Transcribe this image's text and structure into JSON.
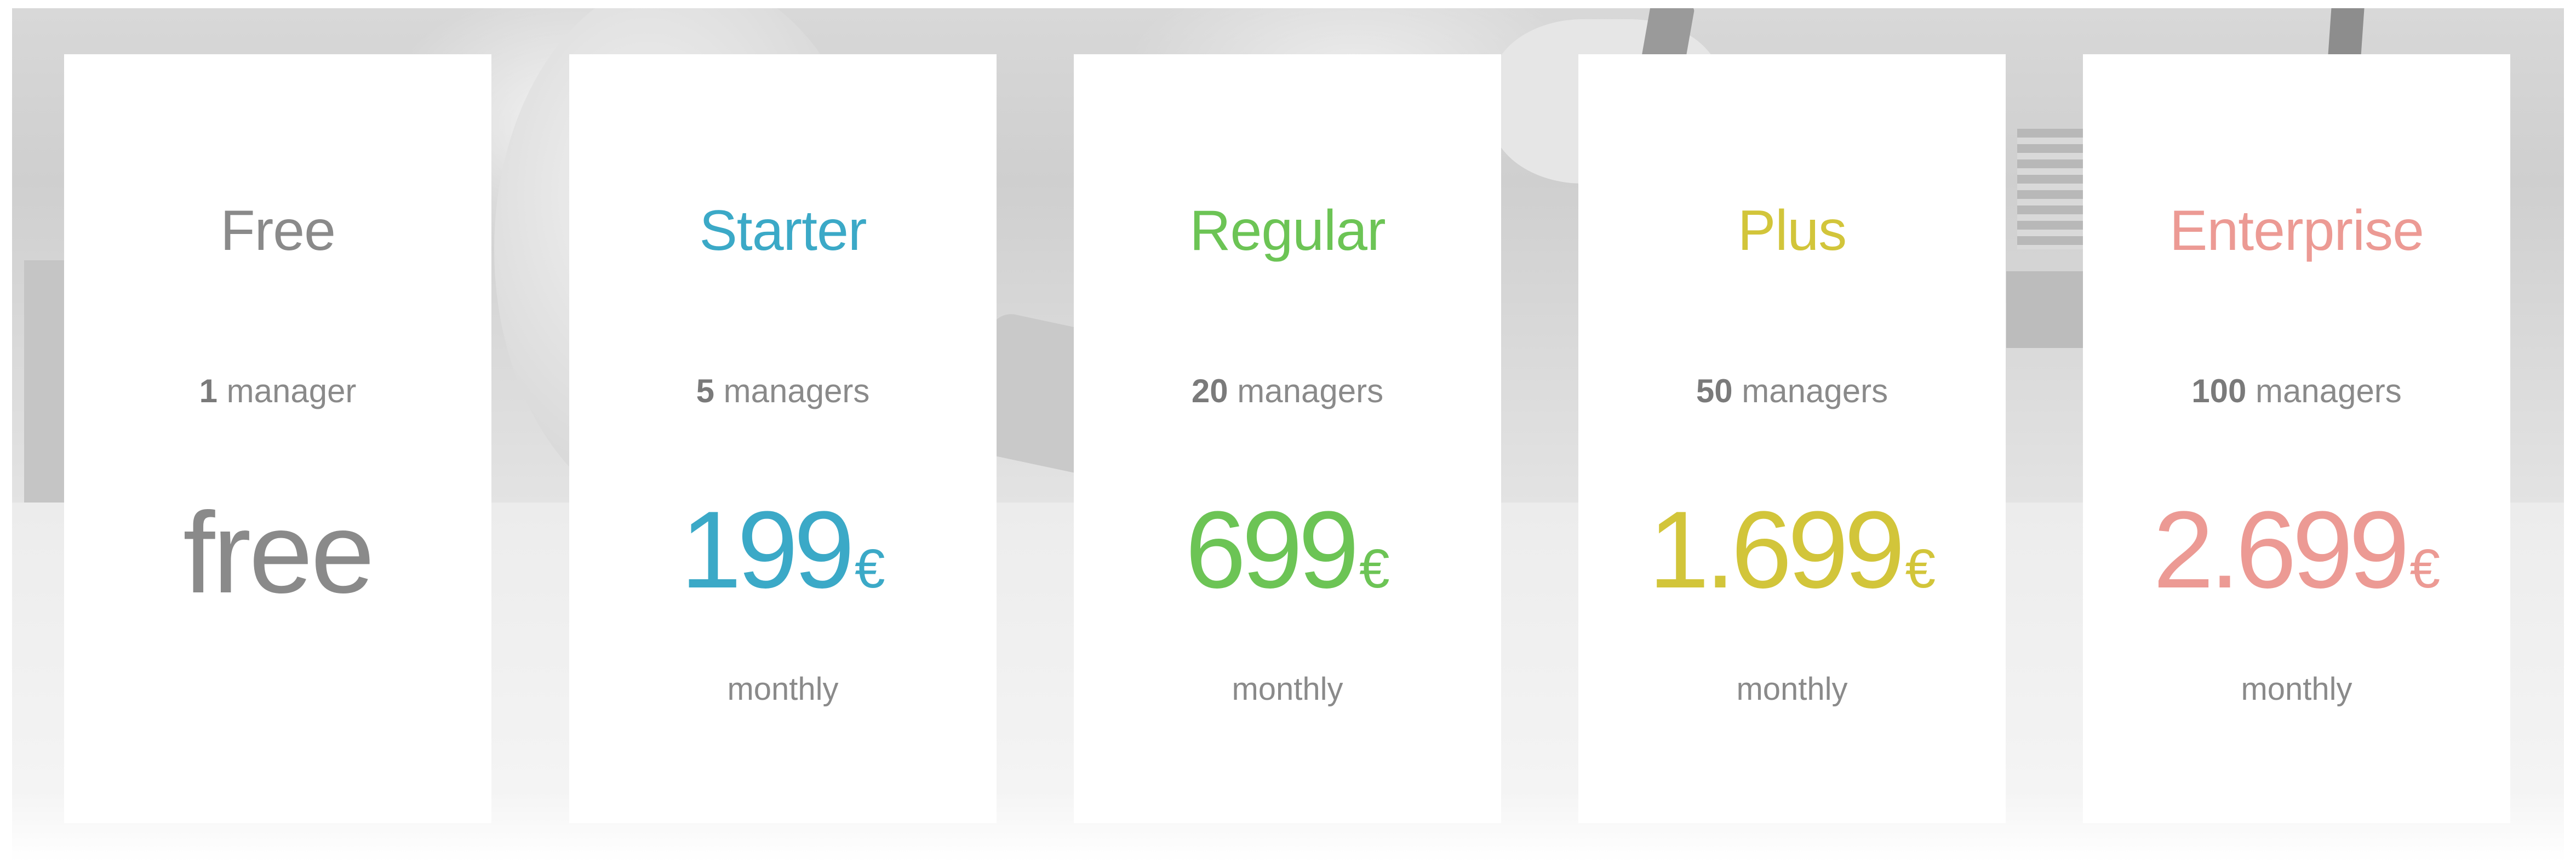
{
  "plans": [
    {
      "name": "Free",
      "manager_count": "1",
      "manager_label": "manager",
      "price_text": "free",
      "currency": "",
      "period": "",
      "color": "#8a8a8a"
    },
    {
      "name": "Starter",
      "manager_count": "5",
      "manager_label": "managers",
      "price_text": "199",
      "currency": "€",
      "period": "monthly",
      "color": "#3ba9c7"
    },
    {
      "name": "Regular",
      "manager_count": "20",
      "manager_label": "managers",
      "price_text": "699",
      "currency": "€",
      "period": "monthly",
      "color": "#6cc455"
    },
    {
      "name": "Plus",
      "manager_count": "50",
      "manager_label": "managers",
      "price_text": "1.699",
      "currency": "€",
      "period": "monthly",
      "color": "#d2c53a"
    },
    {
      "name": "Enterprise",
      "manager_count": "100",
      "manager_label": "managers",
      "price_text": "2.699",
      "currency": "€",
      "period": "monthly",
      "color": "#ec9a94"
    }
  ]
}
